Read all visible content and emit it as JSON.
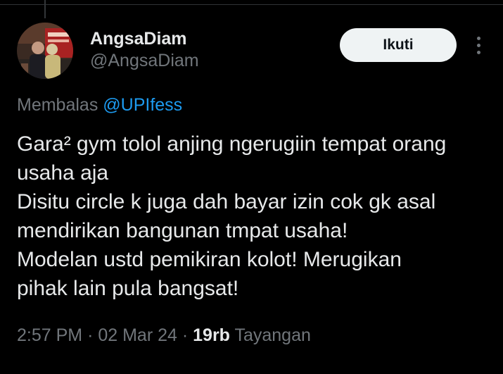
{
  "user": {
    "display_name": "AngsaDiam",
    "handle": "@AngsaDiam"
  },
  "follow_label": "Ikuti",
  "reply": {
    "prefix": "Membalas",
    "mention": "@UPIfess"
  },
  "tweet_lines": [
    "Gara² gym tolol anjing ngerugiin tempat orang",
    "usaha aja",
    "Disitu circle k juga dah bayar izin cok gk asal",
    "mendirikan bangunan tmpat usaha!",
    "Modelan ustd pemikiran kolot! Merugikan",
    "pihak lain pula bangsat!"
  ],
  "meta": {
    "time": "2:57 PM",
    "separator": "·",
    "date": "02 Mar 24",
    "views_count": "19rb",
    "views_label": "Tayangan"
  },
  "colors": {
    "background": "#000000",
    "text_primary": "#e7e9ea",
    "text_secondary": "#71767b",
    "link": "#1d9bf0",
    "follow_bg": "#eff3f4"
  },
  "icons": [
    "more-options-icon"
  ]
}
